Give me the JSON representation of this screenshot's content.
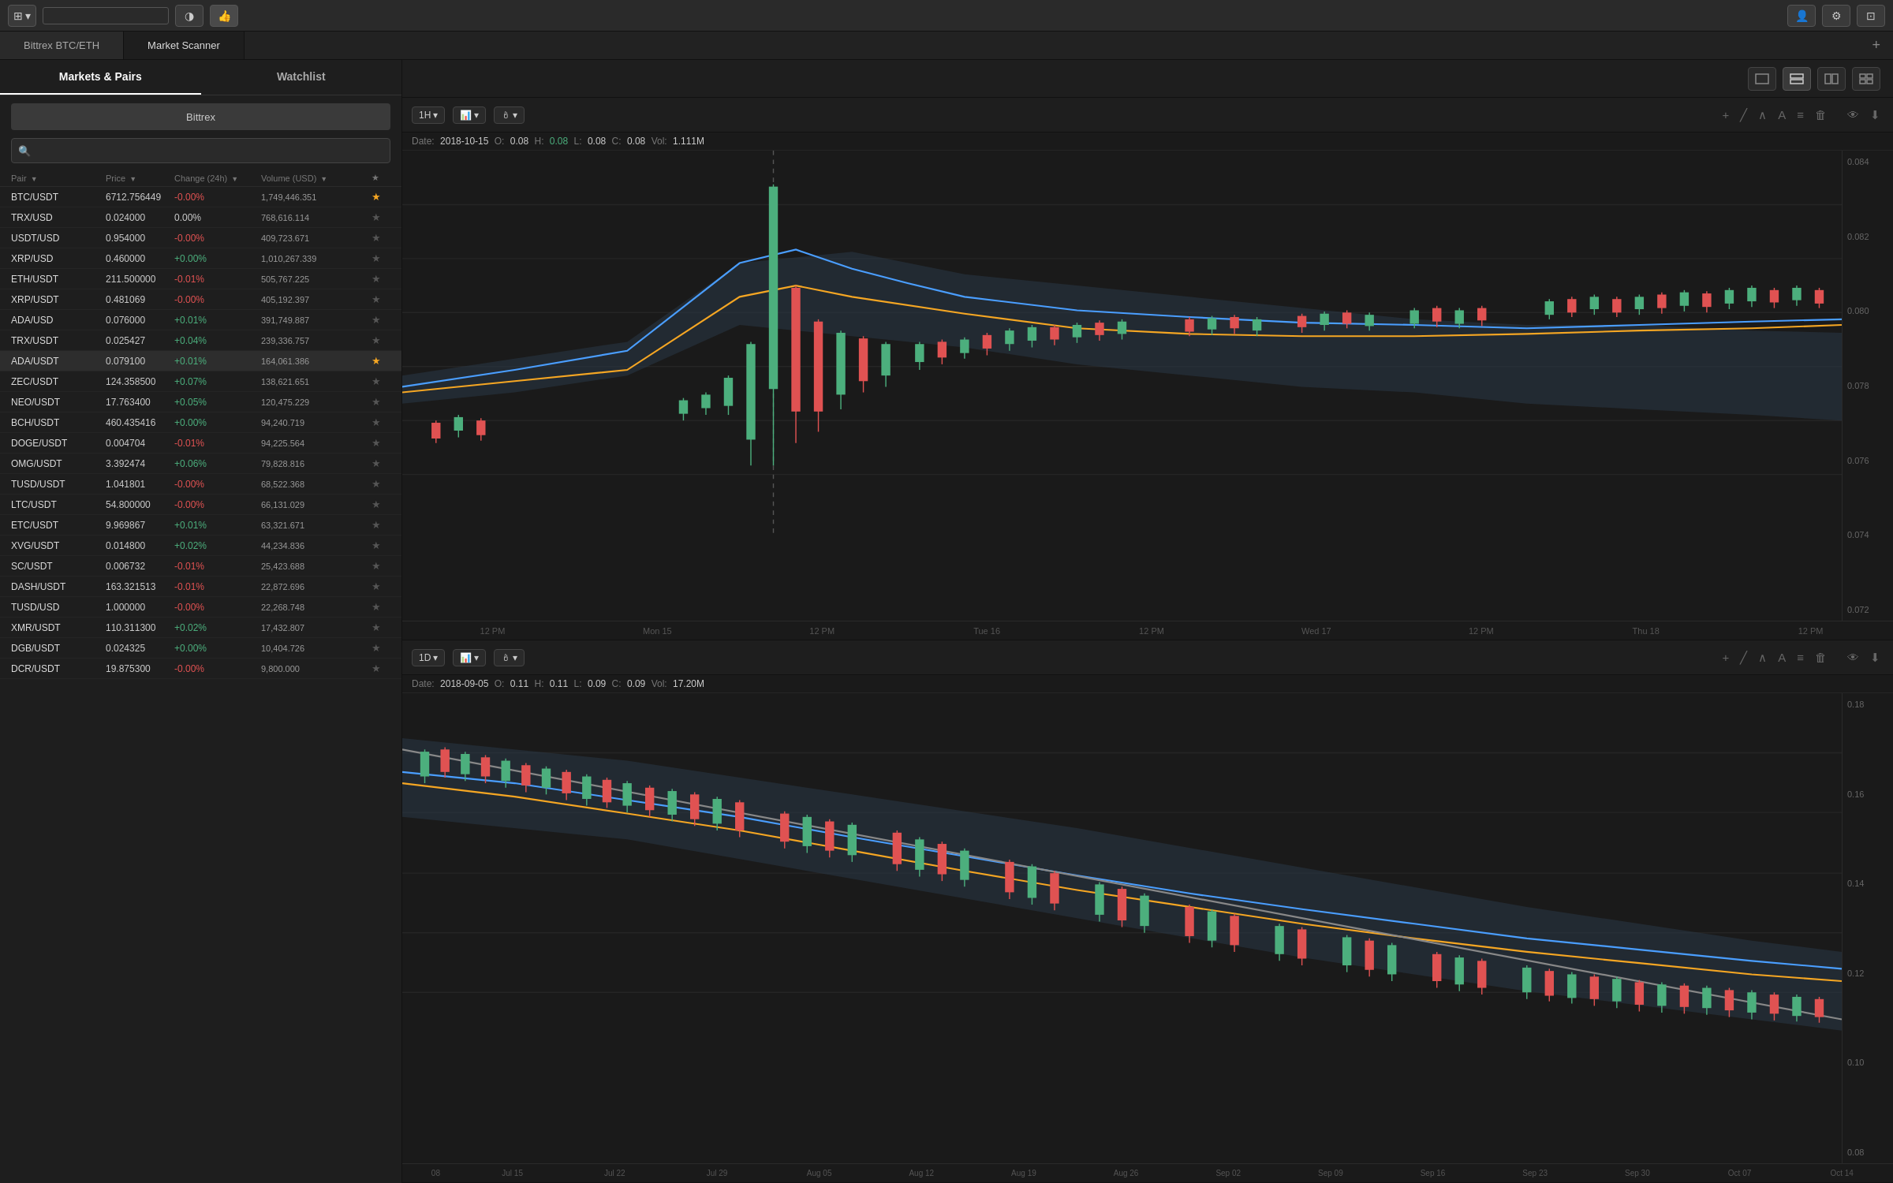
{
  "topBar": {
    "screenBtn": "⊞",
    "themeBtn": "◑",
    "notifBtn": "👍",
    "rightBtns": [
      "👤",
      "⚙",
      "⊡"
    ]
  },
  "tabs": [
    {
      "label": "Bittrex BTC/ETH",
      "active": false
    },
    {
      "label": "Market Scanner",
      "active": true
    }
  ],
  "leftPanel": {
    "tabs": [
      {
        "label": "Markets & Pairs",
        "active": true
      },
      {
        "label": "Watchlist",
        "active": false
      }
    ],
    "exchangeBtn": "Bittrex",
    "searchPlaceholder": "",
    "tableHeaders": {
      "pair": "Pair",
      "price": "Price",
      "change": "Change (24h)",
      "volume": "Volume (USD)"
    },
    "pairs": [
      {
        "name": "BTC/USDT",
        "price": "6712.756449",
        "change": "-0.00%",
        "changeType": "negative",
        "volume": "1,749,446.351",
        "star": true
      },
      {
        "name": "TRX/USD",
        "price": "0.024000",
        "change": "0.00%",
        "changeType": "neutral",
        "volume": "768,616.114",
        "star": false
      },
      {
        "name": "USDT/USD",
        "price": "0.954000",
        "change": "-0.00%",
        "changeType": "negative",
        "volume": "409,723.671",
        "star": false
      },
      {
        "name": "XRP/USD",
        "price": "0.460000",
        "change": "+0.00%",
        "changeType": "positive",
        "volume": "1,010,267.339",
        "star": false
      },
      {
        "name": "ETH/USDT",
        "price": "211.500000",
        "change": "-0.01%",
        "changeType": "negative",
        "volume": "505,767.225",
        "star": false
      },
      {
        "name": "XRP/USDT",
        "price": "0.481069",
        "change": "-0.00%",
        "changeType": "negative",
        "volume": "405,192.397",
        "star": false
      },
      {
        "name": "ADA/USD",
        "price": "0.076000",
        "change": "+0.01%",
        "changeType": "positive",
        "volume": "391,749.887",
        "star": false
      },
      {
        "name": "TRX/USDT",
        "price": "0.025427",
        "change": "+0.04%",
        "changeType": "positive",
        "volume": "239,336.757",
        "star": false
      },
      {
        "name": "ADA/USDT",
        "price": "0.079100",
        "change": "+0.01%",
        "changeType": "positive",
        "volume": "164,061.386",
        "star": true,
        "selected": true
      },
      {
        "name": "ZEC/USDT",
        "price": "124.358500",
        "change": "+0.07%",
        "changeType": "positive",
        "volume": "138,621.651",
        "star": false
      },
      {
        "name": "NEO/USDT",
        "price": "17.763400",
        "change": "+0.05%",
        "changeType": "positive",
        "volume": "120,475.229",
        "star": false
      },
      {
        "name": "BCH/USDT",
        "price": "460.435416",
        "change": "+0.00%",
        "changeType": "positive",
        "volume": "94,240.719",
        "star": false
      },
      {
        "name": "DOGE/USDT",
        "price": "0.004704",
        "change": "-0.01%",
        "changeType": "negative",
        "volume": "94,225.564",
        "star": false
      },
      {
        "name": "OMG/USDT",
        "price": "3.392474",
        "change": "+0.06%",
        "changeType": "positive",
        "volume": "79,828.816",
        "star": false
      },
      {
        "name": "TUSD/USDT",
        "price": "1.041801",
        "change": "-0.00%",
        "changeType": "negative",
        "volume": "68,522.368",
        "star": false
      },
      {
        "name": "LTC/USDT",
        "price": "54.800000",
        "change": "-0.00%",
        "changeType": "negative",
        "volume": "66,131.029",
        "star": false
      },
      {
        "name": "ETC/USDT",
        "price": "9.969867",
        "change": "+0.01%",
        "changeType": "positive",
        "volume": "63,321.671",
        "star": false
      },
      {
        "name": "XVG/USDT",
        "price": "0.014800",
        "change": "+0.02%",
        "changeType": "positive",
        "volume": "44,234.836",
        "star": false
      },
      {
        "name": "SC/USDT",
        "price": "0.006732",
        "change": "-0.01%",
        "changeType": "negative",
        "volume": "25,423.688",
        "star": false
      },
      {
        "name": "DASH/USDT",
        "price": "163.321513",
        "change": "-0.01%",
        "changeType": "negative",
        "volume": "22,872.696",
        "star": false
      },
      {
        "name": "TUSD/USD",
        "price": "1.000000",
        "change": "-0.00%",
        "changeType": "negative",
        "volume": "22,268.748",
        "star": false
      },
      {
        "name": "XMR/USDT",
        "price": "110.311300",
        "change": "+0.02%",
        "changeType": "positive",
        "volume": "17,432.807",
        "star": false
      },
      {
        "name": "DGB/USDT",
        "price": "0.024325",
        "change": "+0.00%",
        "changeType": "positive",
        "volume": "10,404.726",
        "star": false
      },
      {
        "name": "DCR/USDT",
        "price": "19.875300",
        "change": "-0.00%",
        "changeType": "negative",
        "volume": "9,800.000",
        "star": false
      }
    ]
  },
  "chartPanel1": {
    "timeframe": "1H",
    "chartType": "candles",
    "infoDate": "2018-10-15",
    "infoO": "0.08",
    "infoH": "0.08",
    "infoL": "0.08",
    "infoC": "0.08",
    "infoVol": "1.111M",
    "priceScale": [
      "0.084",
      "0.082",
      "0.080",
      "0.078",
      "0.076",
      "0.074",
      "0.072"
    ],
    "timeLabels": [
      "12 PM",
      "Mon 15",
      "12 PM",
      "Tue 16",
      "12 PM",
      "Wed 17",
      "12 PM",
      "Thu 18",
      "12 PM"
    ]
  },
  "chartPanel2": {
    "timeframe": "1D",
    "chartType": "candles",
    "infoDate": "2018-09-05",
    "infoO": "0.11",
    "infoH": "0.11",
    "infoL": "0.09",
    "infoC": "0.09",
    "infoVol": "17.20M",
    "priceScale": [
      "0.18",
      "0.16",
      "0.14",
      "0.12",
      "0.10",
      "0.08"
    ],
    "timeLabels": [
      "08",
      "Jul 15",
      "Jul 22",
      "Jul 29",
      "Aug 05",
      "Aug 12",
      "Aug 19",
      "Aug 26",
      "Sep 02",
      "Sep 09",
      "Sep 16",
      "Sep 23",
      "Sep 30",
      "Oct 07",
      "Oct 14"
    ]
  },
  "layoutButtons": [
    {
      "icon": "▭",
      "name": "single-layout"
    },
    {
      "icon": "⬒",
      "name": "split-h-layout",
      "active": true
    },
    {
      "icon": "⬓",
      "name": "split-v-layout"
    },
    {
      "icon": "⊞",
      "name": "quad-layout"
    }
  ]
}
